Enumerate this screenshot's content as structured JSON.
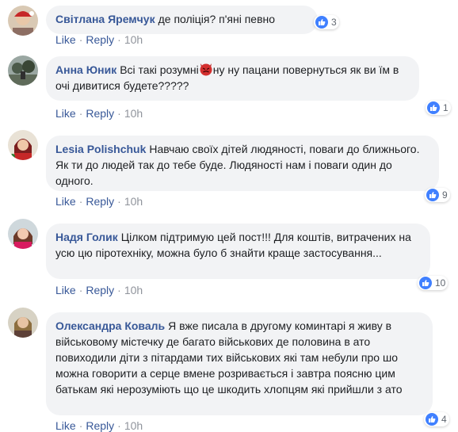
{
  "actions": {
    "like": "Like",
    "reply": "Reply",
    "sep": "·"
  },
  "colors": {
    "author": "#385898",
    "bubble": "#f2f3f5",
    "like_badge": "#4080ff",
    "meta": "#90949c"
  },
  "comments": [
    {
      "author": "Світлана Яремчук",
      "text": "де поліція? п'яні певно",
      "reactions": "3",
      "time": "10h"
    },
    {
      "author": "Анна Юник",
      "text_before": "Всі такі розумні",
      "emoji": "angry-devil-emoji",
      "text": "ну ну пацани повернуться як ви їм в очі дивитися будете?????",
      "reactions": "1",
      "time": "10h"
    },
    {
      "author": "Lesia Polishchuk",
      "text": "Навчаю своїх дітей людяності, поваги до ближнього. Як ти до людей так до тебе буде. Людяності нам і поваги один до одного.",
      "reactions": "9",
      "time": "10h"
    },
    {
      "author": "Надя Голик",
      "text": "Цілком підтримую цей пост!!! Для коштів, витрачених на усю цю піротехніку, можна було б знайти краще застосування...",
      "reactions": "10",
      "time": "10h"
    },
    {
      "author": "Олександра Коваль",
      "text": "Я вже писала в другому коминтарі я живу в військовому містечку де багато військових де половина в ато повиходили діти з пітардами тих військових які там небули про шо можна говорити а серце вмене розривається і завтра поясню цим батькам які нерозуміють що це шкодить хлопцям які прийшли з ато",
      "reactions": "4",
      "time": "10h"
    }
  ]
}
